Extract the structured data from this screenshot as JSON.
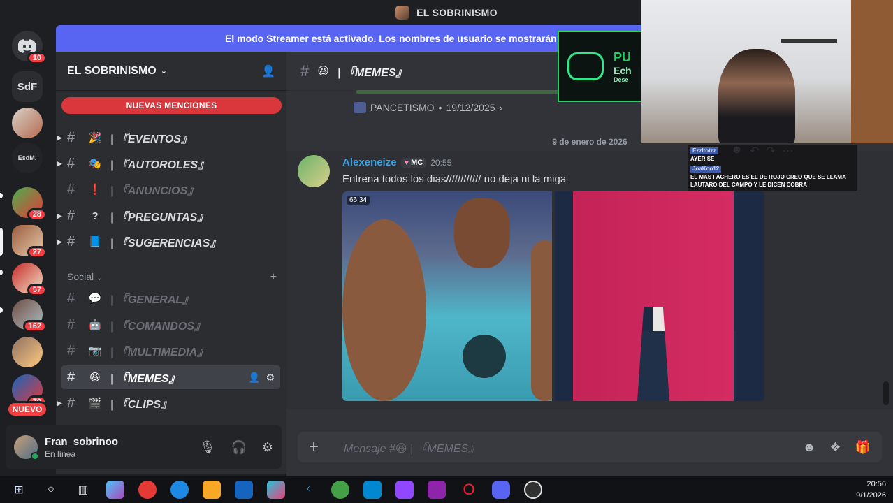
{
  "window": {
    "title": "EL SOBRINISMO"
  },
  "banner": {
    "text": "El modo Streamer está activado. Los nombres de usuario se mostrarán o"
  },
  "guilds": [
    {
      "label": "",
      "badge": "10",
      "icon": "discord-logo"
    },
    {
      "label": "SdF",
      "badge": ""
    },
    {
      "label": "",
      "badge": ""
    },
    {
      "label": "EsdM.",
      "badge": ""
    },
    {
      "label": "",
      "badge": "28"
    },
    {
      "label": "",
      "badge": "27"
    },
    {
      "label": "",
      "badge": "57"
    },
    {
      "label": "",
      "badge": "162"
    },
    {
      "label": "",
      "badge": ""
    },
    {
      "label": "",
      "badge": "70"
    }
  ],
  "nuevo_label": "NUEVO",
  "server": {
    "name": "EL SOBRINISMO",
    "mentions_label": "NUEVAS MENCIONES",
    "channels_top": [
      {
        "emoji": "🎉",
        "name": "| 『EVENTOS』"
      },
      {
        "emoji": "🎭",
        "name": "| 『AUTOROLES』"
      },
      {
        "emoji": "❗",
        "name": "| 『ANUNCIOS』"
      },
      {
        "emoji": "?",
        "name": "| 『PREGUNTAS』"
      },
      {
        "emoji": "📘",
        "name": "| 『SUGERENCIAS』"
      }
    ],
    "category": "Social",
    "channels_social": [
      {
        "emoji": "💬",
        "name": "| 『GENERAL』"
      },
      {
        "emoji": "🤖",
        "name": "| 『COMANDOS』"
      },
      {
        "emoji": "📷",
        "name": "| 『MULTIMEDIA』"
      },
      {
        "emoji": "😆",
        "name": "| 『MEMES』"
      },
      {
        "emoji": "🎬",
        "name": "| 『CLIPS』"
      }
    ]
  },
  "user": {
    "name": "Fran_sobrinoo",
    "status": "En línea"
  },
  "channel_header": {
    "emoji": "😆",
    "name": "| 『MEMES』"
  },
  "thread": {
    "name": "PANCETISMO",
    "date": "19/12/2025"
  },
  "date_divider": "9 de enero de 2026",
  "message": {
    "author": "Alexeneize",
    "tag": "MC",
    "time": "20:55",
    "text": "Entrena todos los dias//////////// no deja ni la miga",
    "video_time": "66:34"
  },
  "composer": {
    "placeholder": "Mensaje #😆 | 『MEMES』"
  },
  "overlay": {
    "brand": "PU",
    "line2": "Ech",
    "line3": "Dese"
  },
  "stream_chat": [
    {
      "user": "Ezzltotzz",
      "text": "AYER SE"
    },
    {
      "user": "JoaKoo12",
      "text": "EL MAS FACHERO ES EL DE ROJO CREO QUE SE LLAMA LAUTARO DEL CAMPO Y LE DICEN COBRA"
    }
  ],
  "taskbar": {
    "time": "20:56",
    "date": "9/1/2026"
  },
  "colors": {
    "accent": "#5865f2",
    "danger": "#f23f43",
    "online": "#23a55a",
    "author": "#3ea1e0"
  }
}
